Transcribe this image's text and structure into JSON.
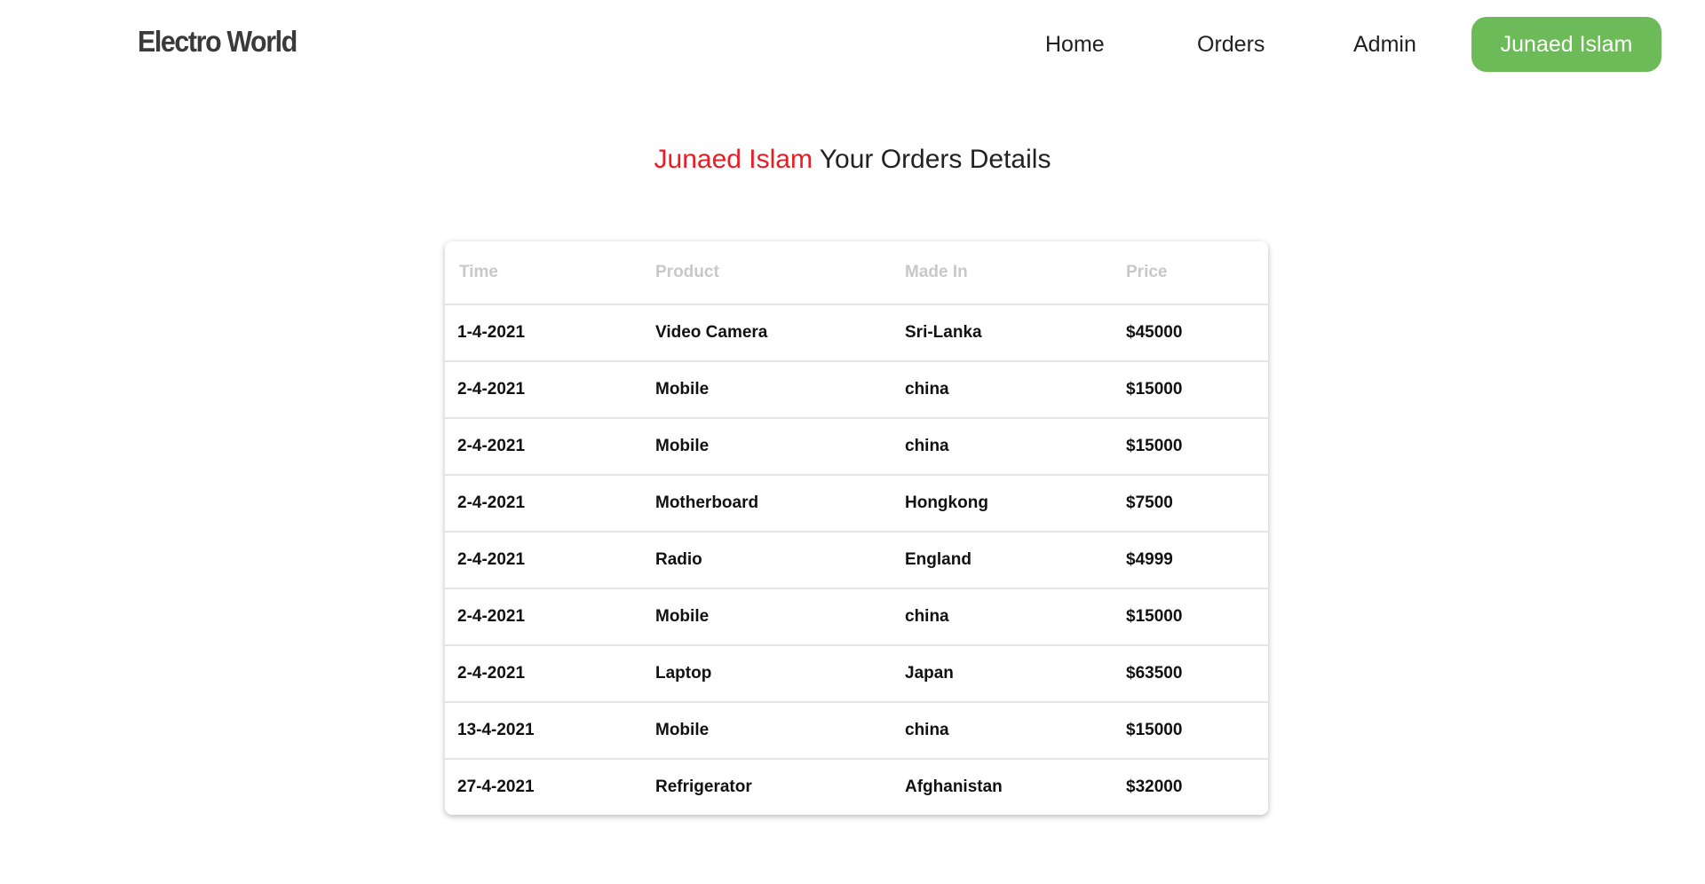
{
  "brand": {
    "name": "Electro World"
  },
  "nav": {
    "home": "Home",
    "orders": "Orders",
    "admin": "Admin",
    "user": "Junaed Islam"
  },
  "colors": {
    "accent_green": "#6dbb58",
    "user_name_red": "#ec1c24"
  },
  "heading": {
    "user_name": "Junaed Islam",
    "suffix": " Your Orders Details"
  },
  "table": {
    "columns": [
      "Time",
      "Product",
      "Made In",
      "Price"
    ],
    "rows": [
      [
        "1-4-2021",
        "Video Camera",
        "Sri-Lanka",
        "$45000"
      ],
      [
        "2-4-2021",
        "Mobile",
        "china",
        "$15000"
      ],
      [
        "2-4-2021",
        "Mobile",
        "china",
        "$15000"
      ],
      [
        "2-4-2021",
        "Motherboard",
        "Hongkong",
        "$7500"
      ],
      [
        "2-4-2021",
        "Radio",
        "England",
        "$4999"
      ],
      [
        "2-4-2021",
        "Mobile",
        "china",
        "$15000"
      ],
      [
        "2-4-2021",
        "Laptop",
        "Japan",
        "$63500"
      ],
      [
        "13-4-2021",
        "Mobile",
        "china",
        "$15000"
      ],
      [
        "27-4-2021",
        "Refrigerator",
        "Afghanistan",
        "$32000"
      ]
    ]
  }
}
